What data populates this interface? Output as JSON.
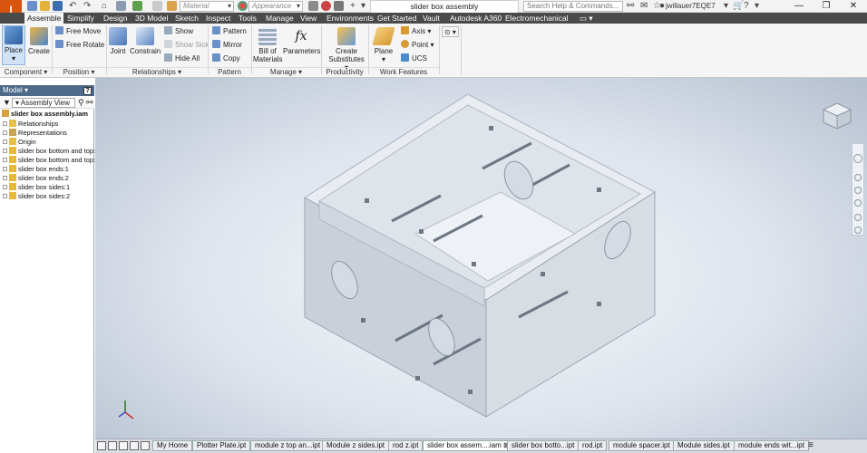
{
  "app": {
    "logo": "I",
    "logo_sub": "PRO"
  },
  "quick_access": {
    "material_placeholder": "Material",
    "appearance_placeholder": "Appearance"
  },
  "title": "slider box assembly",
  "search_placeholder": "Search Help & Commands...",
  "user": "jwillauer7EQE7",
  "tabs": [
    "Assemble",
    "Simplify",
    "Design",
    "3D Model",
    "Sketch",
    "Inspect",
    "Tools",
    "Manage",
    "View",
    "Environments",
    "Get Started",
    "Vault",
    "Autodesk A360",
    "Electromechanical"
  ],
  "ribbon": {
    "place": "Place",
    "create": "Create",
    "free_move": "Free Move",
    "free_rotate": "Free Rotate",
    "joint": "Joint",
    "constrain": "Constrain",
    "show": "Show",
    "show_sick": "Show Sick",
    "hide_all": "Hide All",
    "pattern": "Pattern",
    "mirror": "Mirror",
    "copy": "Copy",
    "bill_of_materials_1": "Bill of",
    "bill_of_materials_2": "Materials",
    "parameters": "Parameters",
    "create_substitutes_1": "Create",
    "create_substitutes_2": "Substitutes",
    "plane": "Plane",
    "axis": "Axis",
    "point": "Point",
    "ucs": "UCS",
    "panels": {
      "component": "Component",
      "position": "Position",
      "relationships": "Relationships",
      "pattern": "Pattern",
      "manage": "Manage",
      "productivity": "Productivity",
      "work_features": "Work Features"
    }
  },
  "browser": {
    "header": "Model",
    "view": "Assembly View",
    "root": "slider box assembly.iam",
    "items": [
      "Relationships",
      "Representations",
      "Origin",
      "slider box bottom and top:1",
      "slider box bottom and top:2",
      "slider box ends:1",
      "slider box ends:2",
      "slider box sides:1",
      "slider box sides:2"
    ]
  },
  "doc_tabs": [
    "My Home",
    "Plotter Plate.ipt",
    "module z top an...ipt",
    "Module z sides.ipt",
    "rod z.ipt",
    "slider box assem....iam",
    "slider box botto...ipt",
    "rod.ipt",
    "module spacer.ipt",
    "Module sides.ipt",
    "module ends wit...ipt"
  ],
  "active_doc_tab": 5,
  "colors": {
    "app_orange": "#d8540e",
    "tab_bar": "#4a4a4a",
    "browser_header": "#4d6a8a"
  }
}
